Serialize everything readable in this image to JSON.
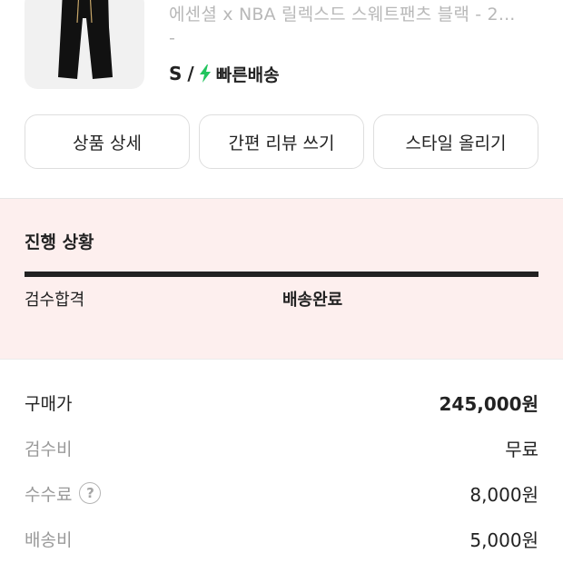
{
  "product": {
    "name_line1": "에센셜 x NBA 릴렉스드 스웨트팬츠 블랙 - 2...",
    "name_line2": "-",
    "size": "S",
    "separator": "/",
    "shipping_badge": "빠른배송",
    "badge_color": "#22c55e",
    "image_icon": "pants-icon"
  },
  "actions": {
    "detail": "상품 상세",
    "review": "간편 리뷰 쓰기",
    "style": "스타일 올리기"
  },
  "progress": {
    "title": "진행 상황",
    "steps": [
      "검수합격",
      "배송완료"
    ],
    "current_step": "배송완료",
    "fill": 1.0
  },
  "price": {
    "rows": [
      {
        "label": "구매가",
        "value": "245,000원"
      },
      {
        "label": "검수비",
        "value": "무료"
      },
      {
        "label": "수수료",
        "value": "8,000원",
        "help_icon": "?"
      },
      {
        "label": "배송비",
        "value": "5,000원"
      }
    ]
  }
}
